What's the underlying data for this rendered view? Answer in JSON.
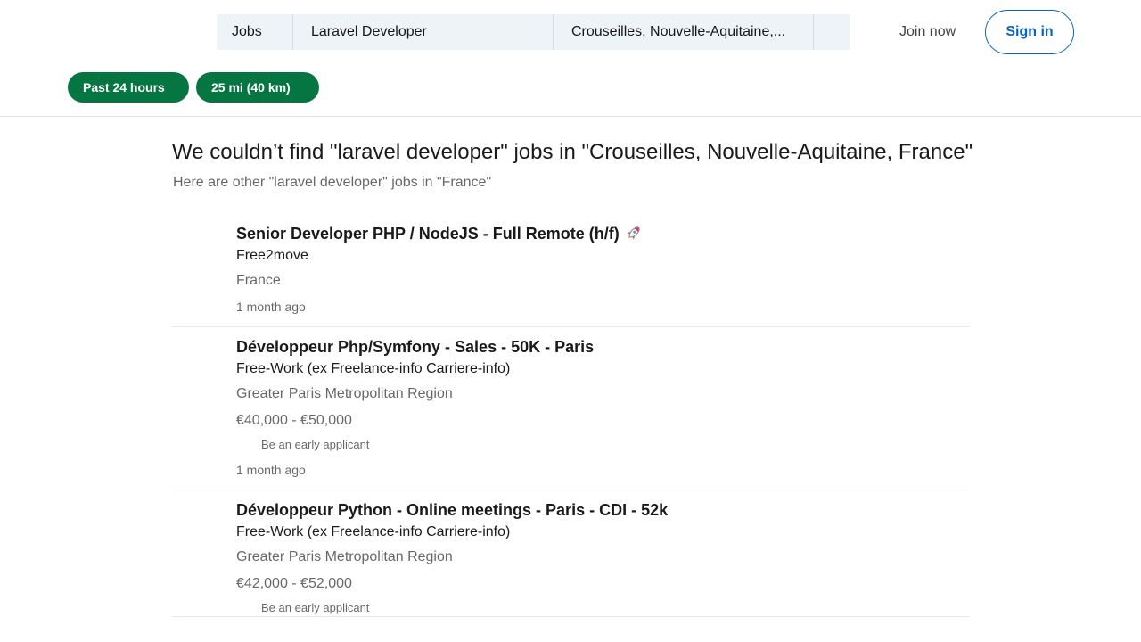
{
  "search": {
    "jobs_label": "Jobs",
    "keyword": "Laravel Developer",
    "location": "Crouseilles, Nouvelle-Aquitaine,..."
  },
  "header": {
    "join_label": "Join now",
    "signin_label": "Sign in"
  },
  "filters": [
    {
      "label": "Past 24 hours"
    },
    {
      "label": "25 mi (40 km)"
    }
  ],
  "message": {
    "headline": "We couldn’t find \"laravel developer\" jobs in \"Crouseilles, Nouvelle-Aquitaine, France\"",
    "subhead": "Here are other \"laravel developer\" jobs in \"France\""
  },
  "jobs": [
    {
      "title": "Senior Developer PHP / NodeJS - Full Remote (h/f)",
      "title_icon": "rocket-icon",
      "company": "Free2move",
      "location": "France",
      "time": "1 month ago"
    },
    {
      "title": "Développeur Php/Symfony - Sales - 50K - Paris",
      "company": "Free-Work (ex Freelance-info Carriere-info)",
      "location": "Greater Paris Metropolitan Region",
      "salary": "€40,000 - €50,000",
      "early": "Be an early applicant",
      "time": "1 month ago"
    },
    {
      "title": "Développeur Python - Online meetings - Paris - CDI - 52k",
      "company": "Free-Work (ex Freelance-info Carriere-info)",
      "location": "Greater Paris Metropolitan Region",
      "salary": "€42,000 - €52,000",
      "early": "Be an early applicant"
    }
  ],
  "colors": {
    "accent": "#0a66c2",
    "filter_active": "#057642",
    "search_bg": "#eef3f8"
  }
}
